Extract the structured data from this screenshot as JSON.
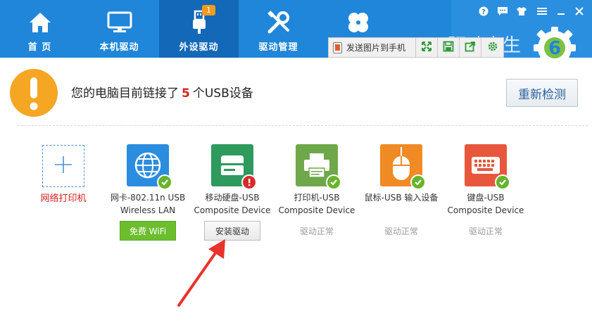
{
  "nav": {
    "tabs": [
      {
        "label": "首 页",
        "icon": "home-icon"
      },
      {
        "label": "本机驱动",
        "icon": "monitor-icon"
      },
      {
        "label": "外设驱动",
        "icon": "usb-icon",
        "badge": "1",
        "active": true
      },
      {
        "label": "驱动管理",
        "icon": "tools-icon"
      },
      {
        "label": "",
        "icon": "clover-icon"
      }
    ]
  },
  "window_controls": [
    "help-icon",
    "message-icon",
    "skin-icon",
    "menu-icon",
    "minimize-icon",
    "close-icon"
  ],
  "toolbar": {
    "send_label": "发送图片到手机",
    "buttons": [
      "expand-icon",
      "save-icon",
      "share-icon",
      "settings-icon"
    ]
  },
  "brand": {
    "text": "驱动人生",
    "logo_number": "6"
  },
  "status": {
    "prefix": "您的电脑目前链接了",
    "count": "5",
    "suffix": "个USB设备",
    "redetect_label": "重新检测"
  },
  "devices": {
    "add_printer_label": "网络打印机",
    "items": [
      {
        "line1": "网卡-802.11n USB",
        "line2": "Wireless LAN",
        "icon": "globe-icon",
        "color": "#2a8de0",
        "status": "ok",
        "action": "免费 WiFi"
      },
      {
        "line1": "移动硬盘-USB",
        "line2": "Composite Device",
        "icon": "hard-drive-icon",
        "color": "#2f9a5e",
        "status": "error",
        "action": "安装驱动"
      },
      {
        "line1": "打印机-USB",
        "line2": "Composite Device",
        "icon": "printer-icon",
        "color": "#6fa84a",
        "status": "ok",
        "action": "驱动正常"
      },
      {
        "line1": "鼠标-USB 输入设备",
        "line2": "",
        "icon": "mouse-icon",
        "color": "#f08a24",
        "status": "ok",
        "action": "驱动正常"
      },
      {
        "line1": "键盘-USB",
        "line2": "Composite Device",
        "icon": "keyboard-icon",
        "color": "#e8573c",
        "status": "ok",
        "action": "驱动正常"
      }
    ]
  },
  "colors": {
    "nav_bg": "#1f86d9",
    "nav_active": "#1468b8",
    "accent_red": "#d6201f",
    "ok_green": "#66b42b",
    "warn_orange": "#f5a623"
  }
}
